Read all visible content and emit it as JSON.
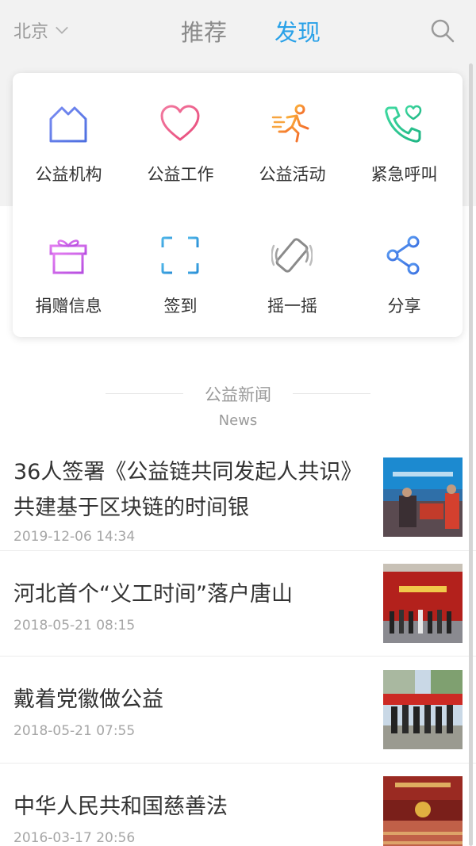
{
  "header": {
    "city": "北京",
    "tabs": [
      {
        "label": "推荐",
        "active": false
      },
      {
        "label": "发现",
        "active": true
      }
    ]
  },
  "services": {
    "items": [
      {
        "label": "公益机构",
        "icon": "building-icon"
      },
      {
        "label": "公益工作",
        "icon": "heart-icon"
      },
      {
        "label": "公益活动",
        "icon": "running-person-icon"
      },
      {
        "label": "紧急呼叫",
        "icon": "phone-heart-icon"
      },
      {
        "label": "捐赠信息",
        "icon": "gift-icon"
      },
      {
        "label": "签到",
        "icon": "scan-icon"
      },
      {
        "label": "摇一摇",
        "icon": "shake-phone-icon"
      },
      {
        "label": "分享",
        "icon": "share-icon"
      }
    ]
  },
  "news_section": {
    "title": "公益新闻",
    "subtitle": "News"
  },
  "news": [
    {
      "title": "36人签署《公益链共同发起人共识》 共建基于区块链的时间银",
      "time": "2019-12-06 14:34"
    },
    {
      "title": "河北首个“义工时间”落户唐山",
      "time": "2018-05-21 08:15"
    },
    {
      "title": "戴着党徽做公益",
      "time": "2018-05-21 07:55"
    },
    {
      "title": "中华人民共和国慈善法",
      "time": "2016-03-17 20:56"
    }
  ],
  "colors": {
    "accent": "#29a1e8",
    "muted": "#9a9a9a"
  }
}
